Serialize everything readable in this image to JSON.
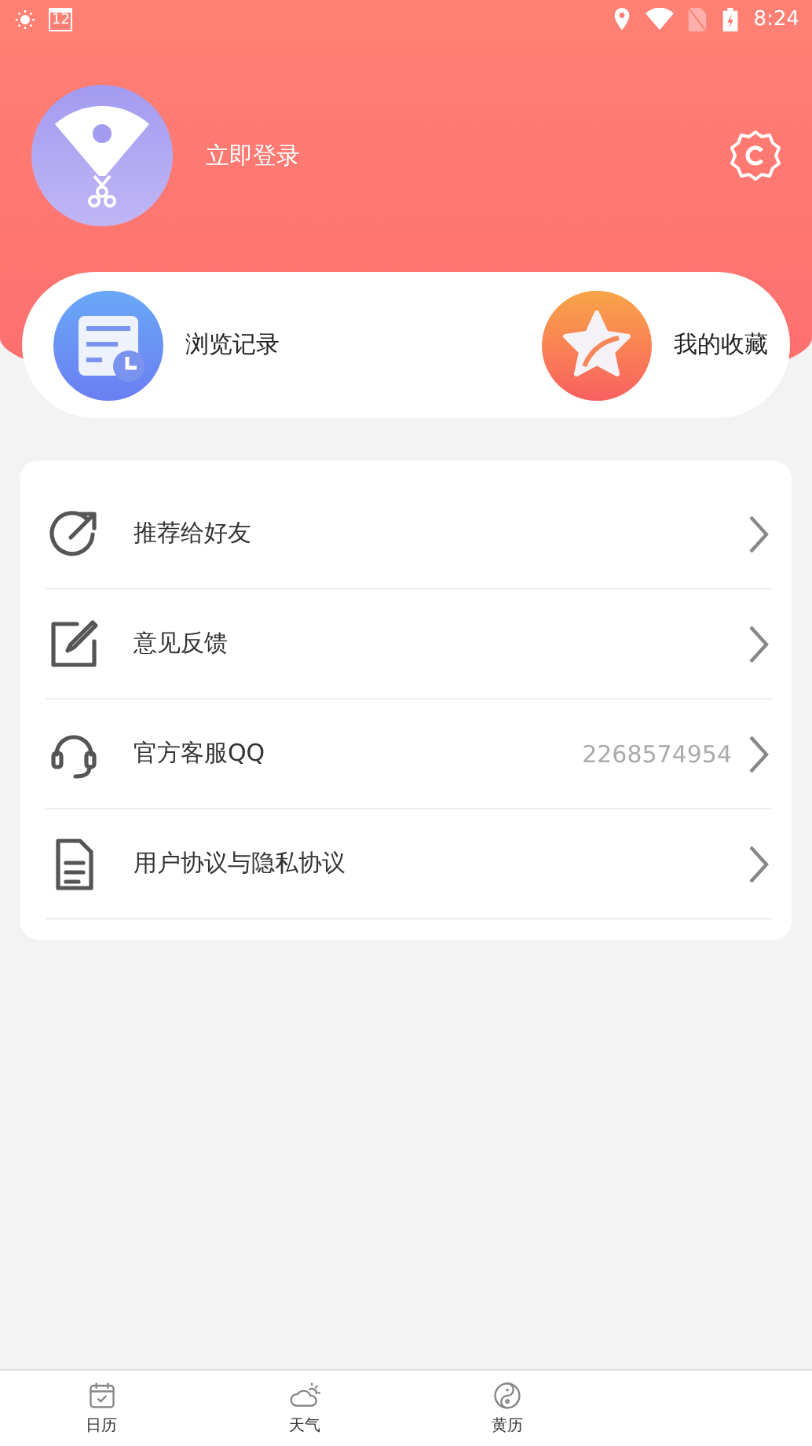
{
  "status_bar": {
    "calendar_day": "12",
    "time": "8:24"
  },
  "profile": {
    "login_label": "立即登录"
  },
  "shortcuts": [
    {
      "kind": "history",
      "label": "浏览记录"
    },
    {
      "kind": "favorites",
      "label": "我的收藏"
    }
  ],
  "menu": [
    {
      "kind": "share",
      "label": "推荐给好友"
    },
    {
      "kind": "feedback",
      "label": "意见反馈"
    },
    {
      "kind": "support",
      "label": "官方客服QQ",
      "value": "2268574954"
    },
    {
      "kind": "document",
      "label": "用户协议与隐私协议"
    }
  ],
  "bottom_nav": [
    {
      "kind": "calendar",
      "label": "日历"
    },
    {
      "kind": "weather",
      "label": "天气"
    },
    {
      "kind": "almanac",
      "label": "黄历"
    }
  ]
}
